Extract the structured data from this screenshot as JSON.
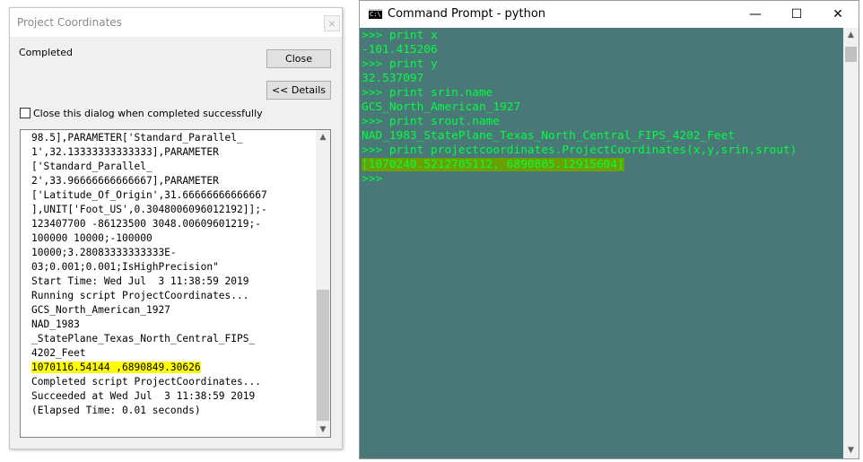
{
  "dialog": {
    "title": "Project Coordinates",
    "close_x": "×",
    "status": "Completed",
    "close_button": "Close",
    "details_button": "<< Details",
    "checkbox_label": "Close this dialog when completed successfully",
    "log_lines": [
      "98.5],PARAMETER['Standard_Parallel_",
      "1',32.13333333333333],PARAMETER",
      "['Standard_Parallel_",
      "2',33.96666666666667],PARAMETER",
      "['Latitude_Of_Origin',31.66666666666667",
      "],UNIT['Foot_US',0.3048006096012192]];-",
      "123407700 -86123500 3048.00609601219;-",
      "100000 10000;-100000",
      "10000;3.28083333333333E-",
      "03;0.001;0.001;IsHighPrecision\"",
      "Start Time: Wed Jul  3 11:38:59 2019",
      "Running script ProjectCoordinates...",
      "GCS_North_American_1927",
      "NAD_1983",
      "_StatePlane_Texas_North_Central_FIPS_",
      "4202_Feet",
      "1070116.54144 ,6890849.30626",
      "Completed script ProjectCoordinates...",
      "Succeeded at Wed Jul  3 11:38:59 2019",
      "(Elapsed Time: 0.01 seconds)"
    ],
    "highlighted_line_index": 16
  },
  "console": {
    "title": "Command Prompt - python",
    "icon_label": "C:\\",
    "minimize": "—",
    "maximize": "☐",
    "close": "✕",
    "lines": [
      ">>> print x",
      "-101.415206",
      ">>> print y",
      "32.537097",
      ">>> print srin.name",
      "GCS_North_American_1927",
      ">>> print srout.name",
      "NAD_1983_StatePlane_Texas_North_Central_FIPS_4202_Feet",
      ">>> print projectcoordinates.ProjectCoordinates(x,y,srin,srout)",
      "[1070240.5212705112, 6890805.12915604]",
      ">>>"
    ],
    "highlighted_line_index": 9
  },
  "colors": {
    "console_bg": "#4a7878",
    "console_text": "#00ff40",
    "dialog_highlight": "#ffff00",
    "console_highlight": "#6aa000"
  }
}
